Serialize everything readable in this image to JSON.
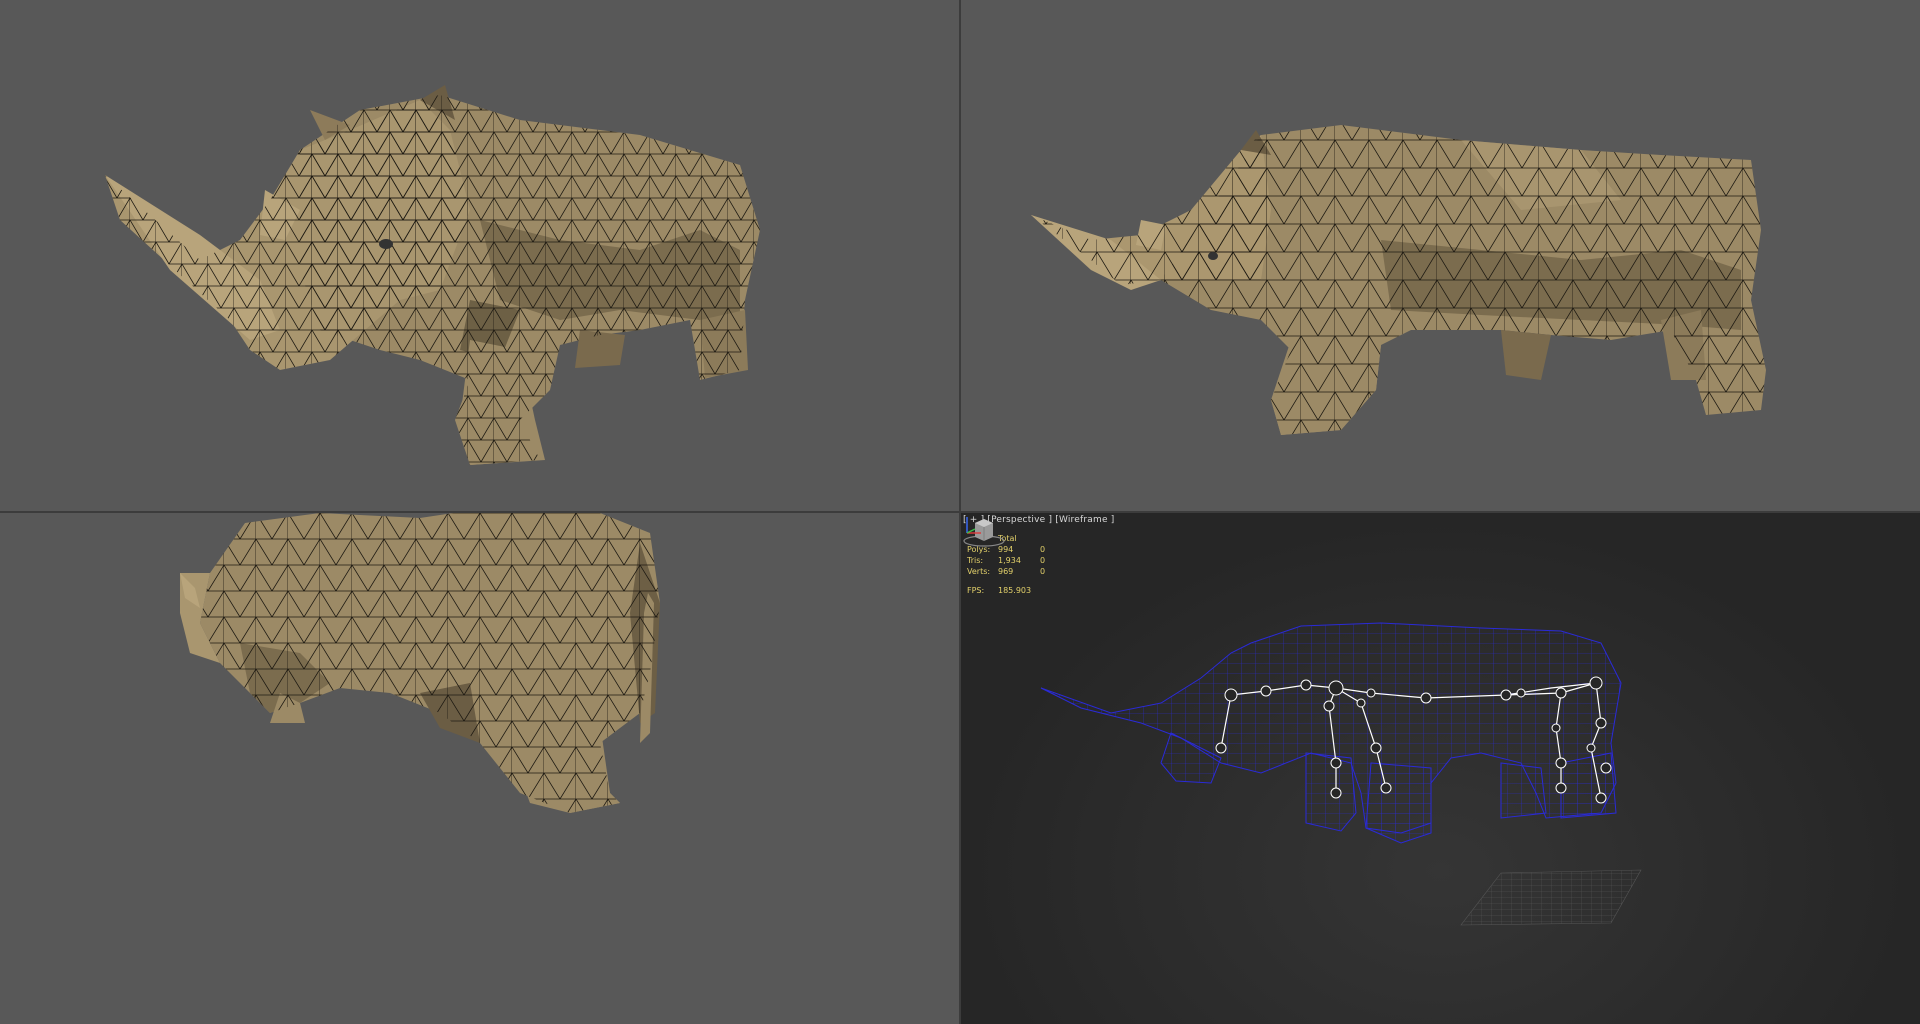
{
  "viewports": {
    "top_left": {
      "name": "perspective-front-three-quarter"
    },
    "top_right": {
      "name": "perspective-side"
    },
    "bottom_left": {
      "name": "perspective-rear-three-quarter"
    },
    "bottom_right": {
      "label": {
        "plus": "[ + ]",
        "view": "[Perspective ]",
        "mode": "[Wireframe ]"
      },
      "stats": {
        "header": "Total",
        "rows": [
          {
            "key": "Polys:",
            "total": "994",
            "sel": "0"
          },
          {
            "key": "Tris:",
            "total": "1,934",
            "sel": "0"
          },
          {
            "key": "Verts:",
            "total": "969",
            "sel": "0"
          }
        ],
        "fps_label": "FPS:",
        "fps_value": "185.903"
      }
    }
  },
  "colors": {
    "viewport_bg": "#585858",
    "wire_bg": "#262626",
    "mesh_fill": "#9c8a66",
    "mesh_edge": "#1e1a12",
    "wire_color": "#2a2ad8",
    "bone_color": "#ffffff",
    "stats_color": "#e2d06a"
  },
  "icons": [
    "viewcube-icon",
    "axis-tripod-icon"
  ]
}
